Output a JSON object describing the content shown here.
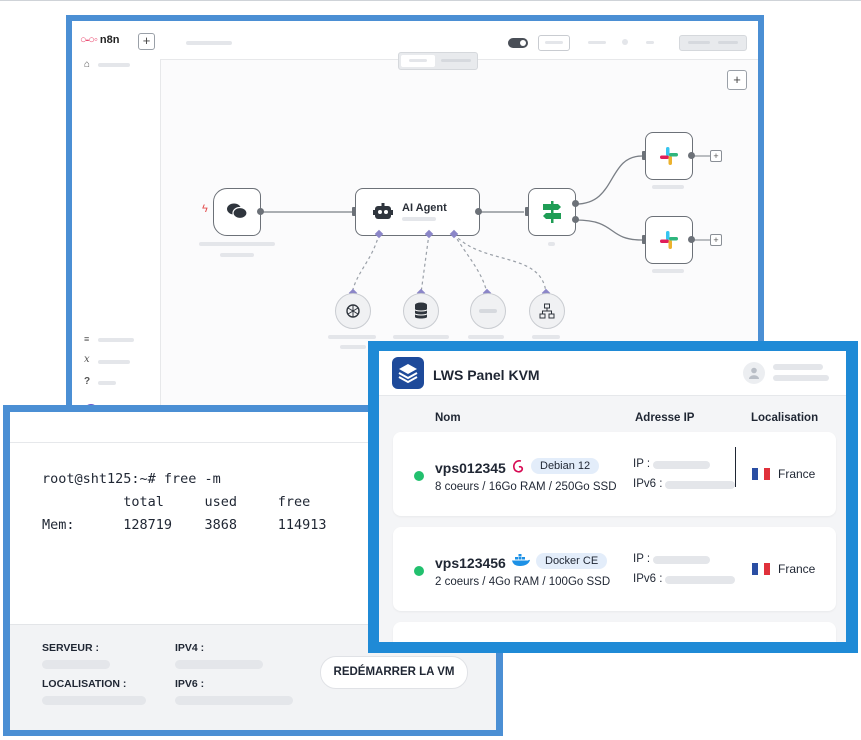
{
  "n8n": {
    "logo_text": "n8n",
    "new_button": "+",
    "canvas_add_button": "+",
    "nodes": {
      "agent_title": "AI Agent"
    },
    "icons": {
      "logo": "n8n-logo-icon",
      "home": "home-icon",
      "trigger": "chat-trigger-icon",
      "agent": "robot-icon",
      "switch": "signpost-icon",
      "slack": "slack-icon",
      "openai": "openai-icon",
      "memory": "database-icon",
      "tool": "network-icon"
    },
    "sidebar_bottom_icons": [
      "templates-icon",
      "variables-icon",
      "help-icon"
    ],
    "sidebar_bottom_glyphs": [
      "𝑥",
      "?"
    ]
  },
  "terminal": {
    "prompt_line": "root@sht125:~# free -m",
    "header_line": "          total     used     free",
    "mem_line": "Mem:      128719    3868     114913",
    "footer": {
      "server_label": "SERVEUR :",
      "ipv4_label": "IPV4 :",
      "location_label": "LOCALISATION :",
      "ipv6_label": "IPV6 :",
      "restart_label": "REDÉMARRER LA VM"
    }
  },
  "lws": {
    "title": "LWS Panel KVM",
    "columns": {
      "name": "Nom",
      "ip": "Adresse IP",
      "location": "Localisation"
    },
    "servers": [
      {
        "name": "vps012345",
        "os_badge": "Debian 12",
        "os_icon": "debian-icon",
        "specs": "8 coeurs / 16Go RAM / 250Go SSD",
        "ip_label": "IP :",
        "ipv6_label": "IPv6 :",
        "country": "France",
        "status_color": "#22c06e"
      },
      {
        "name": "vps123456",
        "os_badge": "Docker CE",
        "os_icon": "docker-icon",
        "specs": "2 coeurs / 4Go RAM / 100Go SSD",
        "ip_label": "IP :",
        "ipv6_label": "IPv6 :",
        "country": "France",
        "status_color": "#22c06e"
      }
    ],
    "colors": {
      "frame": "#1f8ad6",
      "logo_bg": "#1e4a9a",
      "status_online": "#22c06e",
      "badge_bg": "#e3edfa"
    }
  }
}
